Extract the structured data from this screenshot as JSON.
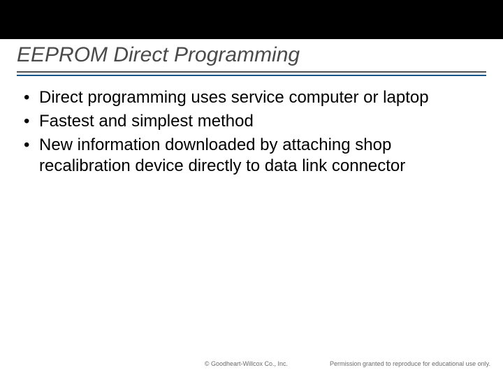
{
  "title": "EEPROM Direct Programming",
  "bullets": [
    "Direct programming uses service computer or laptop",
    "Fastest and simplest method",
    "New information downloaded by attaching shop recalibration device directly to data link connector"
  ],
  "footer": {
    "copyright": "© Goodheart-Willcox Co., Inc.",
    "permission": "Permission granted to reproduce for educational use only."
  }
}
